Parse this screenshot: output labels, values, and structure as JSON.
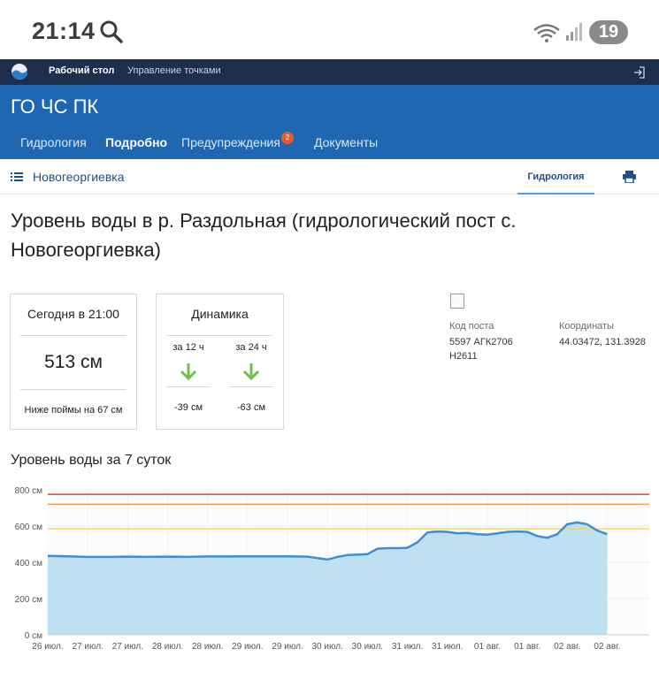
{
  "status_bar": {
    "time": "21:14",
    "battery": "19"
  },
  "top_bar": {
    "links": [
      "Рабочий стол",
      "Управление точками"
    ]
  },
  "header": {
    "title": "ГО ЧС ПК",
    "nav": [
      "Гидрология",
      "Подробно",
      "Предупреждения",
      "Документы"
    ],
    "warnings_badge": "2"
  },
  "sub_bar": {
    "station": "Новогеоргиевка",
    "tab": "Гидрология"
  },
  "page": {
    "title": "Уровень воды в р. Раздольная (гидрологический пост с. Новогеоргиевка)"
  },
  "today_card": {
    "heading": "Сегодня в 21:00",
    "value": "513 см",
    "note": "Ниже поймы на 67 см"
  },
  "dynamics_card": {
    "heading": "Динамика",
    "col1_label": "за 12 ч",
    "col1_value": "-39 см",
    "col2_label": "за 24 ч",
    "col2_value": "-63 см",
    "arrow_color": "#6cc04a"
  },
  "info": {
    "code_label": "Код поста",
    "code_value_line1": "5597 АГК2706",
    "code_value_line2": "Н2611",
    "coords_label": "Координаты",
    "coords_value": "44.03472, 131.3928"
  },
  "chart_title": "Уровень воды за 7 суток",
  "chart_data": {
    "type": "area",
    "title": "Уровень воды за 7 суток",
    "y_unit": "см",
    "ylim": [
      0,
      800
    ],
    "y_ticks": [
      0,
      200,
      400,
      600,
      800
    ],
    "y_tick_labels": [
      "0 см",
      "200 см",
      "400 см",
      "600 см",
      "800 см"
    ],
    "x_tick_labels": [
      "26 июл.",
      "27 июл.",
      "27 июл.",
      "28 июл.",
      "28 июл.",
      "29 июл.",
      "29 июл.",
      "30 июл.",
      "30 июл.",
      "31 июл.",
      "31 июл.",
      "01 авг.",
      "01 авг.",
      "02 авг.",
      "02 авг."
    ],
    "thresholds": [
      {
        "value": 775,
        "color": "#d9463c"
      },
      {
        "value": 720,
        "color": "#f0a04b"
      },
      {
        "value": 585,
        "color": "#f2d36b"
      }
    ],
    "series": [
      {
        "color": "#3d8fd1",
        "fill": "#bfe0f1",
        "x": [
          0,
          0.5,
          1,
          1.5,
          2,
          2.5,
          3,
          3.5,
          4,
          4.5,
          5,
          5.5,
          6,
          6.5,
          7,
          7.25,
          7.5,
          7.75,
          8,
          8.25,
          8.5,
          8.75,
          9,
          9.25,
          9.5,
          9.75,
          10,
          10.25,
          10.5,
          10.75,
          11,
          11.25,
          11.5,
          11.75,
          12,
          12.25,
          12.5,
          12.75,
          13,
          13.25,
          13.5,
          13.75,
          14
        ],
        "values": [
          435,
          433,
          430,
          430,
          431,
          430,
          431,
          430,
          432,
          432,
          433,
          433,
          433,
          431,
          415,
          430,
          440,
          442,
          445,
          475,
          478,
          478,
          480,
          510,
          565,
          570,
          568,
          560,
          562,
          555,
          552,
          560,
          568,
          570,
          568,
          545,
          535,
          555,
          610,
          620,
          610,
          575,
          555
        ]
      }
    ],
    "grid": true
  }
}
